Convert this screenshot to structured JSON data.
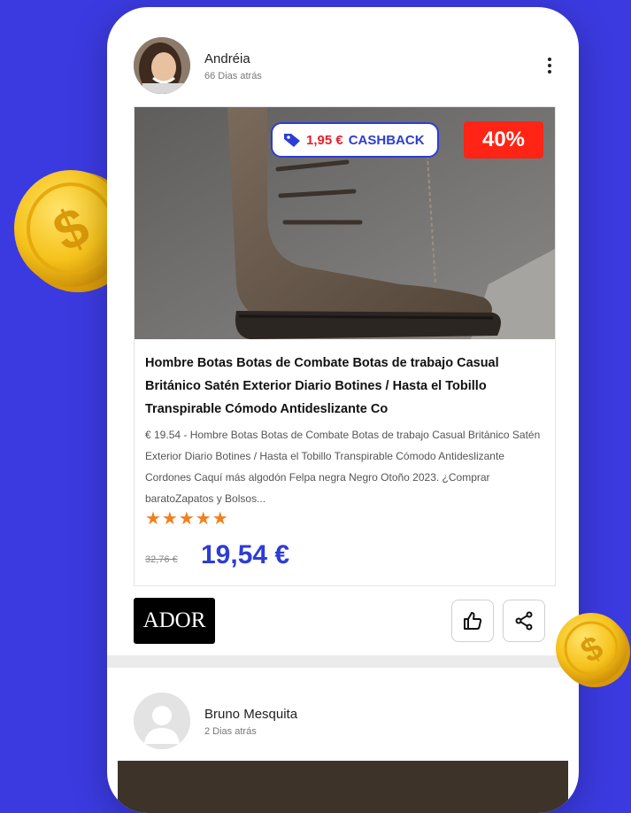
{
  "post": {
    "username": "Andréia",
    "time": "66 Dias atrás",
    "badge_cashback_amount": "1,95 €",
    "badge_cashback_label": "CASHBACK",
    "badge_discount": "40%",
    "title": "Hombre Botas Botas de Combate Botas de trabajo Casual Británico Satén Exterior Diario Botines / Hasta el Tobillo Transpirable Cómodo Antideslizante Co",
    "description": "€ 19.54 - Hombre Botas Botas de Combate Botas de trabajo Casual Británico Satén Exterior Diario Botines / Hasta el Tobillo Transpirable Cómodo Antideslizante Cordones Caquí más algodón Felpa negra Negro Otoño 2023. ¿Comprar baratoZapatos y Bolsos...",
    "stars": "★★★★★",
    "rating": 5,
    "old_price": "32,76 €",
    "new_price": "19,54 €",
    "brand": "ADOR"
  },
  "post2": {
    "username": "Bruno Mesquita",
    "time": "2 Dias atrás"
  },
  "icons": {
    "more": "more-vertical-icon",
    "like": "thumbs-up-icon",
    "share": "share-icon",
    "tag": "tag-icon",
    "coin": "dollar-coin-icon"
  },
  "colors": {
    "background": "#3b3ae0",
    "accent_blue": "#2e3cd6",
    "discount_red": "#ff2415",
    "stars": "#f0801e"
  }
}
